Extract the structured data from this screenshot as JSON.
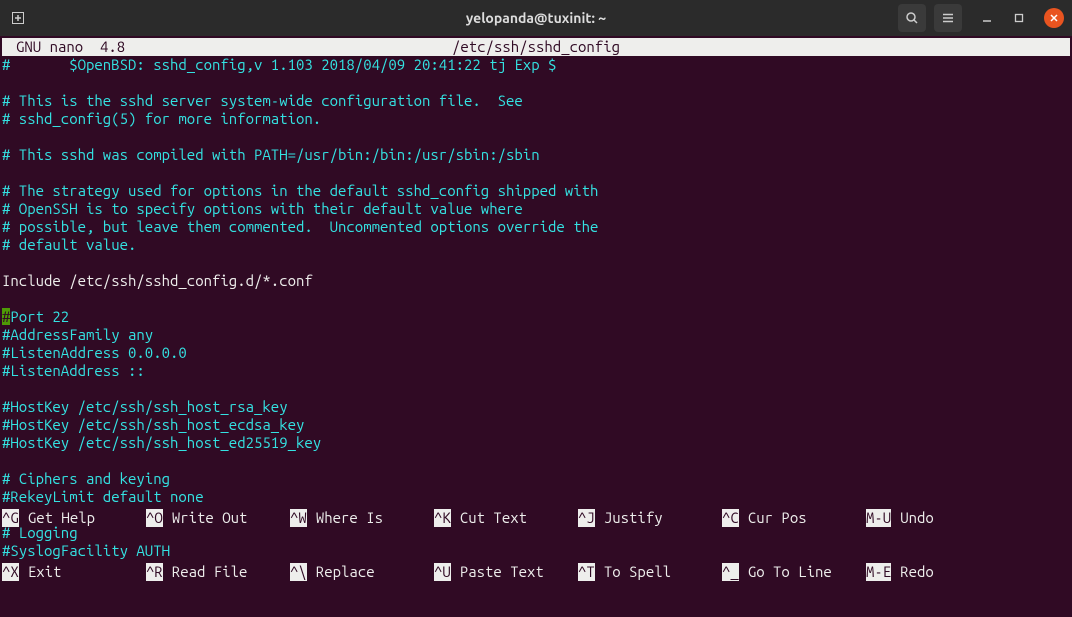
{
  "titlebar": {
    "title": "yelopanda@tuxinit: ~"
  },
  "nano": {
    "version_label": "GNU nano  4.8",
    "filepath": "/etc/ssh/sshd_config"
  },
  "file": {
    "cursor_char": "#",
    "cursor_after": "Port 22",
    "lines": [
      {
        "comment": true,
        "text": "#       $OpenBSD: sshd_config,v 1.103 2018/04/09 20:41:22 tj Exp $"
      },
      {
        "comment": false,
        "text": ""
      },
      {
        "comment": true,
        "text": "# This is the sshd server system-wide configuration file.  See"
      },
      {
        "comment": true,
        "text": "# sshd_config(5) for more information."
      },
      {
        "comment": false,
        "text": ""
      },
      {
        "comment": true,
        "text": "# This sshd was compiled with PATH=/usr/bin:/bin:/usr/sbin:/sbin"
      },
      {
        "comment": false,
        "text": ""
      },
      {
        "comment": true,
        "text": "# The strategy used for options in the default sshd_config shipped with"
      },
      {
        "comment": true,
        "text": "# OpenSSH is to specify options with their default value where"
      },
      {
        "comment": true,
        "text": "# possible, but leave them commented.  Uncommented options override the"
      },
      {
        "comment": true,
        "text": "# default value."
      },
      {
        "comment": false,
        "text": ""
      },
      {
        "comment": false,
        "text": "Include /etc/ssh/sshd_config.d/*.conf"
      },
      {
        "comment": false,
        "text": ""
      },
      {
        "cursor": true
      },
      {
        "comment": true,
        "text": "#AddressFamily any"
      },
      {
        "comment": true,
        "text": "#ListenAddress 0.0.0.0"
      },
      {
        "comment": true,
        "text": "#ListenAddress ::"
      },
      {
        "comment": false,
        "text": ""
      },
      {
        "comment": true,
        "text": "#HostKey /etc/ssh/ssh_host_rsa_key"
      },
      {
        "comment": true,
        "text": "#HostKey /etc/ssh/ssh_host_ecdsa_key"
      },
      {
        "comment": true,
        "text": "#HostKey /etc/ssh/ssh_host_ed25519_key"
      },
      {
        "comment": false,
        "text": ""
      },
      {
        "comment": true,
        "text": "# Ciphers and keying"
      },
      {
        "comment": true,
        "text": "#RekeyLimit default none"
      },
      {
        "comment": false,
        "text": ""
      },
      {
        "comment": true,
        "text": "# Logging"
      },
      {
        "comment": true,
        "text": "#SyslogFacility AUTH"
      }
    ]
  },
  "shortcuts": {
    "row1": [
      {
        "key": "^G",
        "label": "Get Help"
      },
      {
        "key": "^O",
        "label": "Write Out"
      },
      {
        "key": "^W",
        "label": "Where Is"
      },
      {
        "key": "^K",
        "label": "Cut Text"
      },
      {
        "key": "^J",
        "label": "Justify"
      },
      {
        "key": "^C",
        "label": "Cur Pos"
      },
      {
        "key": "M-U",
        "label": "Undo"
      }
    ],
    "row2": [
      {
        "key": "^X",
        "label": "Exit"
      },
      {
        "key": "^R",
        "label": "Read File"
      },
      {
        "key": "^\\",
        "label": "Replace"
      },
      {
        "key": "^U",
        "label": "Paste Text"
      },
      {
        "key": "^T",
        "label": "To Spell"
      },
      {
        "key": "^_",
        "label": "Go To Line"
      },
      {
        "key": "M-E",
        "label": "Redo"
      }
    ]
  }
}
